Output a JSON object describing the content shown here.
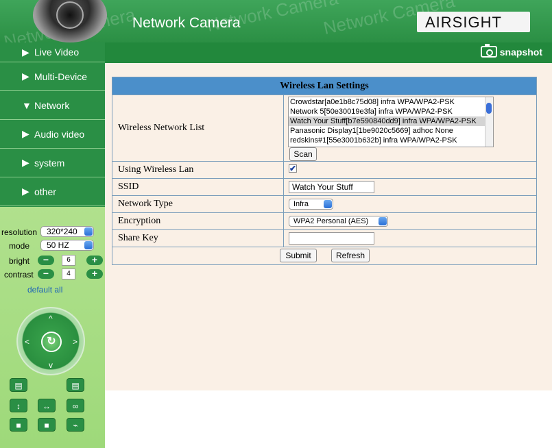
{
  "header": {
    "title": "Network Camera",
    "brand": "AIRSIGHT",
    "watermark": "Network Camera"
  },
  "subbar": {
    "snapshot_label": "snapshot"
  },
  "sidebar": {
    "items": [
      {
        "label": "Live Video",
        "arrow": "▶"
      },
      {
        "label": "Multi-Device",
        "arrow": "▶"
      },
      {
        "label": "Network",
        "arrow": "▼"
      },
      {
        "label": "Audio video",
        "arrow": "▶"
      },
      {
        "label": "system",
        "arrow": "▶"
      },
      {
        "label": "other",
        "arrow": "▶"
      }
    ],
    "controls": {
      "resolution_label": "resolution",
      "resolution_value": "320*240",
      "mode_label": "mode",
      "mode_value": "50 HZ",
      "bright_label": "bright",
      "bright_value": "6",
      "contrast_label": "contrast",
      "contrast_value": "4",
      "minus": "−",
      "plus": "+",
      "default_all": "default all"
    },
    "joystick": {
      "center": "↻",
      "up": "^",
      "down": "v",
      "left": "<",
      "right": ">"
    }
  },
  "panel": {
    "title": "Wireless Lan Settings",
    "network_list_label": "Wireless Network List",
    "networks": [
      "Crowdstar[a0e1b8c75d08] infra WPA/WPA2-PSK",
      "Network 5[50e30019e3fa] infra WPA/WPA2-PSK",
      "Watch Your Stuff[b7e590840dd9] infra WPA/WPA2-PSK",
      "Panasonic Display1[1be9020c5669] adhoc None",
      "redskins#1[55e3001b632b] infra WPA/WPA2-PSK"
    ],
    "scan_label": "Scan",
    "using_wireless_label": "Using Wireless Lan",
    "using_wireless_checked": "✔",
    "ssid_label": "SSID",
    "ssid_value": "Watch Your Stuff",
    "network_type_label": "Network Type",
    "network_type_value": "Infra",
    "encryption_label": "Encryption",
    "encryption_value": "WPA2 Personal (AES)",
    "share_key_label": "Share Key",
    "share_key_value": "",
    "submit_label": "Submit",
    "refresh_label": "Refresh"
  }
}
